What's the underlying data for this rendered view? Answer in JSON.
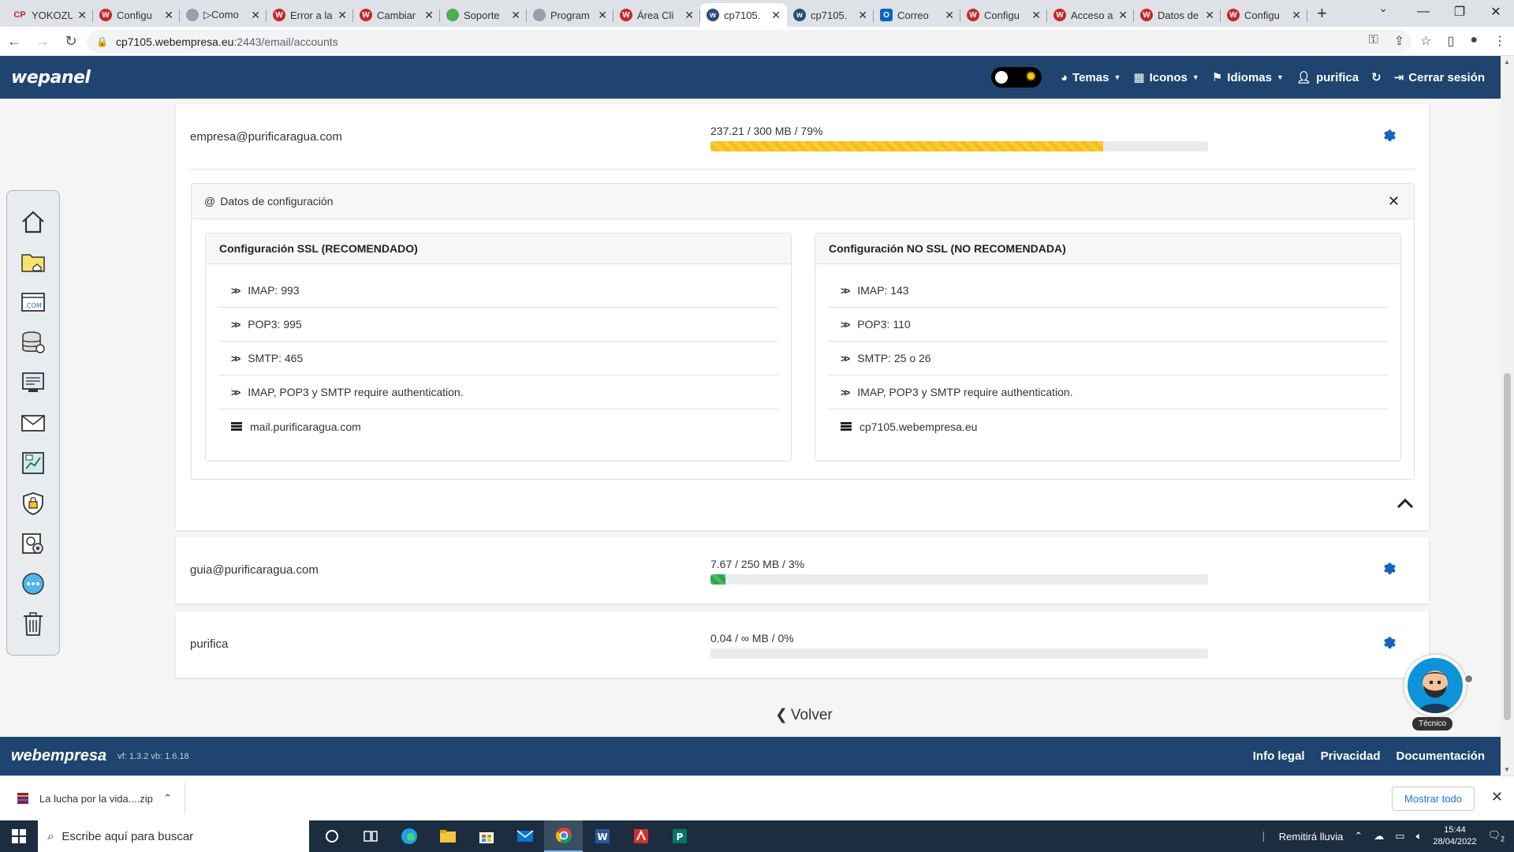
{
  "browser": {
    "tabs": [
      {
        "title": "YOKOZU",
        "icon": "cpanel-icon"
      },
      {
        "title": "Configu",
        "icon": "webempresa-icon"
      },
      {
        "title": "▷Como",
        "icon": "generic-icon"
      },
      {
        "title": "Error a la",
        "icon": "webempresa-icon"
      },
      {
        "title": "Cambiar",
        "icon": "webempresa-icon"
      },
      {
        "title": "Soporte",
        "icon": "green-icon"
      },
      {
        "title": "Program",
        "icon": "generic-icon"
      },
      {
        "title": "Área Cli",
        "icon": "webempresa-icon"
      },
      {
        "title": "cp7105.",
        "icon": "wepanel-icon"
      },
      {
        "title": "cp7105.",
        "icon": "wepanel-icon"
      },
      {
        "title": "Correo",
        "icon": "outlook-icon"
      },
      {
        "title": "Configu",
        "icon": "webempresa-icon"
      },
      {
        "title": "Acceso a",
        "icon": "webempresa-icon"
      },
      {
        "title": "Datos de",
        "icon": "webempresa-icon"
      },
      {
        "title": "Configu",
        "icon": "webempresa-icon"
      }
    ],
    "url_host": "cp7105.webempresa.eu",
    "url_rest": ":2443/email/accounts"
  },
  "header": {
    "logo": "wepanel",
    "menu": {
      "temas": "Temas",
      "iconos": "Iconos",
      "idiomas": "Idiomas",
      "user": "purifica",
      "logout": "Cerrar sesión"
    }
  },
  "accounts": [
    {
      "email": "empresa@purificaragua.com",
      "quota": "237.21 / 300 MB / 79%",
      "percent": 79,
      "color": "#f6c012"
    },
    {
      "email": "guia@purificaragua.com",
      "quota": "7.67 / 250 MB / 3%",
      "percent": 3,
      "color": "#28a745"
    },
    {
      "email": "purifica",
      "quota": "0.04 / ∞ MB / 0%",
      "percent": 0,
      "color": "#28a745"
    }
  ],
  "config": {
    "title": "Datos de configuración",
    "ssl": {
      "title": "Configuración SSL (RECOMENDADO)",
      "imap": "IMAP: 993",
      "pop3": "POP3: 995",
      "smtp": "SMTP: 465",
      "auth": "IMAP, POP3 y SMTP require authentication.",
      "server": "mail.purificaragua.com"
    },
    "nossl": {
      "title": "Configuración NO SSL (NO RECOMENDADA)",
      "imap": "IMAP: 143",
      "pop3": "POP3: 110",
      "smtp": "SMTP: 25 o 26",
      "auth": "IMAP, POP3 y SMTP require authentication.",
      "server": "cp7105.webempresa.eu"
    }
  },
  "volver": "Volver",
  "bot_label": "Técnico",
  "footer": {
    "logo": "webempresa",
    "version": "vf: 1.3.2 vb: 1.6.18",
    "links": [
      "Info legal",
      "Privacidad",
      "Documentación"
    ]
  },
  "download": {
    "file": "La lucha por la vida....zip",
    "show_all": "Mostrar todo"
  },
  "taskbar": {
    "search_placeholder": "Escribe aquí para buscar",
    "weather": "Remitirá lluvia",
    "time": "15:44",
    "date": "28/04/2022",
    "notifications": "2"
  },
  "colors": {
    "header_bg": "#1f4470",
    "accent": "#1565c0"
  }
}
